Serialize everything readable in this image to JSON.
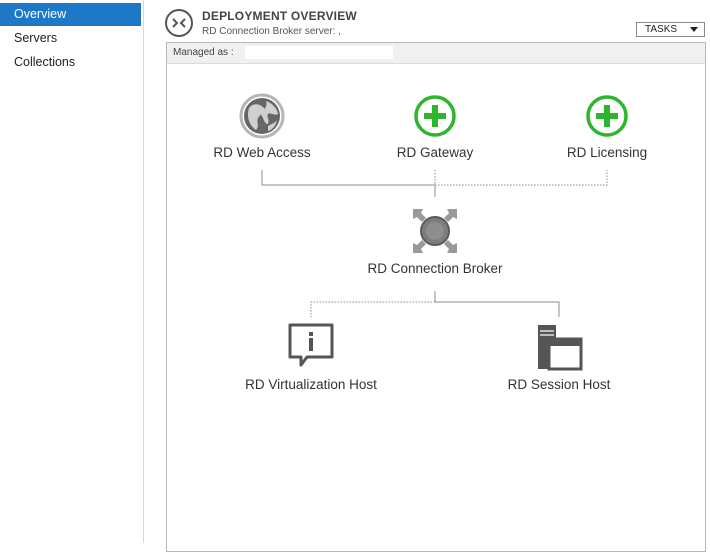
{
  "sidebar": {
    "items": [
      {
        "label": "Overview",
        "active": true
      },
      {
        "label": "Servers",
        "active": false
      },
      {
        "label": "Collections",
        "active": false
      }
    ]
  },
  "header": {
    "title": "DEPLOYMENT OVERVIEW",
    "subtitle": "RD Connection Broker server: ,",
    "tasks_label": "TASKS"
  },
  "panel": {
    "managed_label": "Managed as :"
  },
  "roles": {
    "web_access": "RD Web Access",
    "gateway": "RD Gateway",
    "licensing": "RD Licensing",
    "connection_broker": "RD Connection Broker",
    "virtualization_host": "RD Virtualization Host",
    "session_host": "RD Session Host"
  },
  "colors": {
    "accent": "#1e78c8",
    "add_green": "#2db52d",
    "line_gray": "#8c8c8c"
  },
  "icons": {
    "web_access": "globe-icon",
    "gateway": "add-circle-icon",
    "licensing": "add-circle-icon",
    "connection_broker": "connection-broker-icon",
    "virtualization_host": "info-speech-icon",
    "session_host": "server-window-icon"
  }
}
